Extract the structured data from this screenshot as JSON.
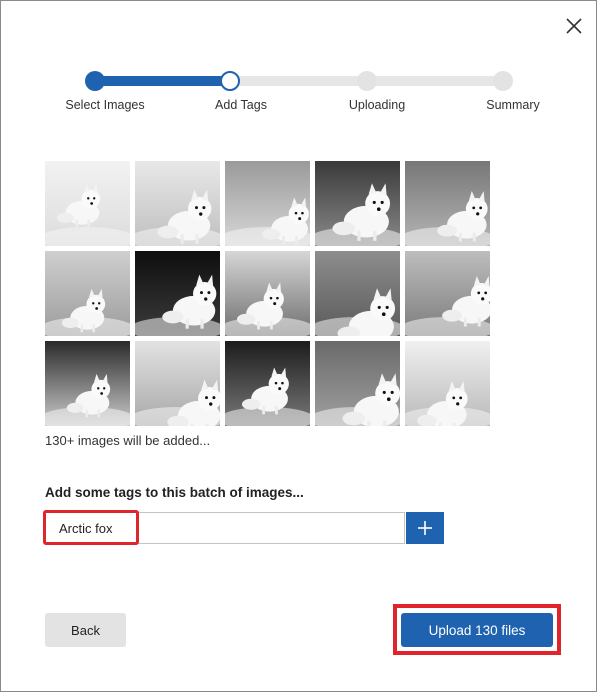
{
  "dialog": {
    "close_icon": "close-icon"
  },
  "stepper": {
    "steps": [
      {
        "label": "Select Images",
        "state": "done"
      },
      {
        "label": "Add Tags",
        "state": "current"
      },
      {
        "label": "Uploading",
        "state": "future"
      },
      {
        "label": "Summary",
        "state": "future"
      }
    ],
    "accent_color": "#1f63b0"
  },
  "images": {
    "thumbnail_count": 15,
    "subject": "arctic fox",
    "count_text": "130+ images will be added..."
  },
  "tags": {
    "label": "Add some tags to this batch of images...",
    "input_value": "Arctic fox",
    "add_icon": "plus-icon"
  },
  "footer": {
    "back_label": "Back",
    "upload_label": "Upload 130 files"
  },
  "colors": {
    "primary": "#1f63b0",
    "highlight": "#e0242c",
    "secondary_button": "#e3e3e3"
  }
}
